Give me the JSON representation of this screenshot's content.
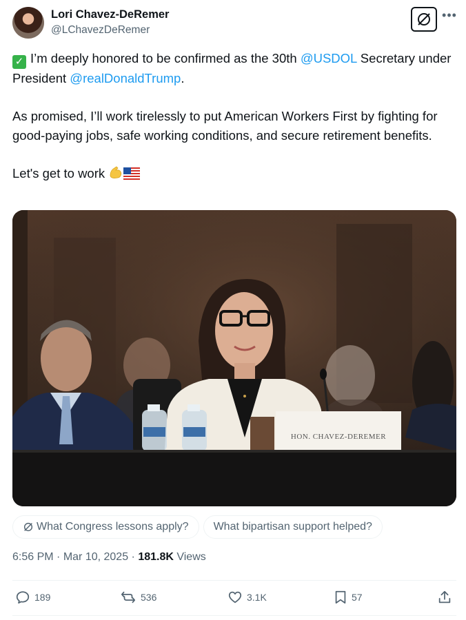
{
  "author": {
    "name": "Lori Chavez-DeRemer",
    "handle": "@LChavezDeRemer"
  },
  "tweet": {
    "line1_pre": "I’m deeply honored to be confirmed as the 30th ",
    "mention_usdol": "@USDOL",
    "line1_post": " Secretary under President ",
    "mention_trump": "@realDonaldTrump",
    "line1_end": ".",
    "paragraph2": "As promised, I’ll work tirelessly to put American Workers First by fighting for good-paying jobs, safe working conditions, and secure retirement benefits.",
    "paragraph3": "Let's get to work",
    "check_emoji": "✅",
    "end_emojis": [
      "💪",
      "🇺🇸"
    ]
  },
  "photo": {
    "nameplate_text": "HON. CHAVEZ-DEREMER"
  },
  "grok_prompts": [
    "What Congress lessons apply?",
    "What bipartisan support helped?"
  ],
  "meta": {
    "time": "6:56 PM",
    "separator": " · ",
    "date": "Mar 10, 2025",
    "views_count": "181.8K",
    "views_label": " Views"
  },
  "actions": {
    "replies": "189",
    "reposts": "536",
    "likes": "3.1K",
    "bookmarks": "57"
  },
  "colors": {
    "link": "#1d9bf0",
    "secondary_text": "#536471",
    "primary_text": "#0f1419",
    "divider": "#eff3f4"
  }
}
